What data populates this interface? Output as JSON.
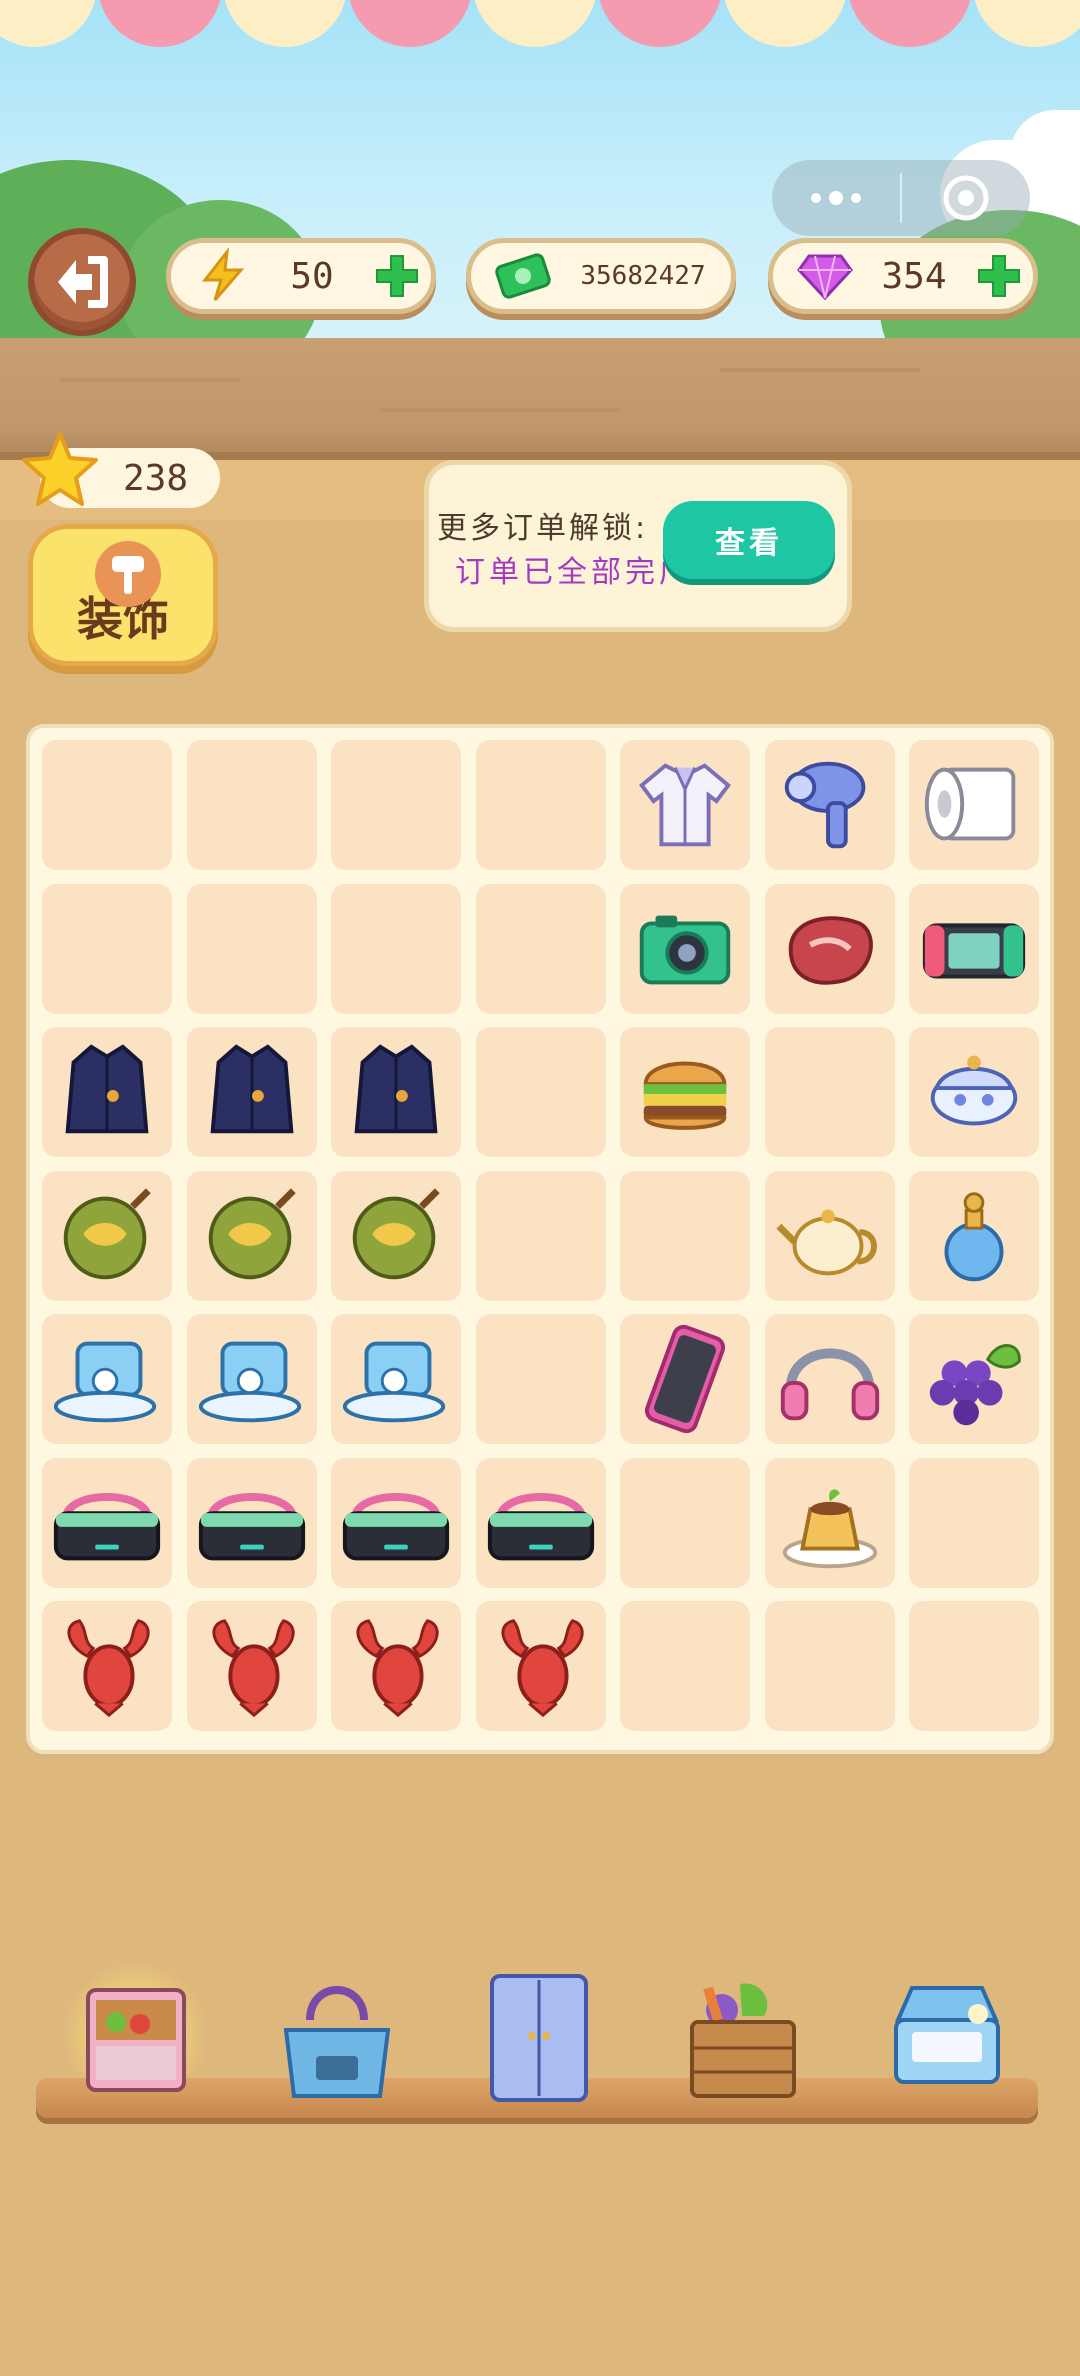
{
  "header": {
    "energy": "50",
    "cash": "35682427",
    "gems": "354"
  },
  "stars": "238",
  "decorate_label": "装饰",
  "order_notice": {
    "line1": "更多订单解锁:",
    "line2": "订单已全部完成",
    "view_label": "查看"
  },
  "board": {
    "rows": 7,
    "cols": 7,
    "cells": [
      [
        "empty",
        "empty",
        "empty",
        "empty",
        "shirt",
        "hair-dryer",
        "toilet-paper"
      ],
      [
        "empty",
        "empty",
        "empty",
        "empty",
        "camera",
        "steak",
        "game-console"
      ],
      [
        "coat",
        "coat",
        "coat",
        "empty",
        "burger",
        "empty",
        "sugar-bowl"
      ],
      [
        "durian",
        "durian",
        "durian",
        "empty",
        "empty",
        "teapot",
        "perfume"
      ],
      [
        "robot-vacuum",
        "robot-vacuum",
        "robot-vacuum",
        "empty",
        "smartphone",
        "headphones",
        "grapes"
      ],
      [
        "vr-headset",
        "vr-headset",
        "vr-headset",
        "vr-headset",
        "empty",
        "pudding",
        "empty"
      ],
      [
        "lobster",
        "lobster",
        "lobster",
        "lobster",
        "empty",
        "empty",
        "empty"
      ]
    ]
  },
  "shelf": [
    "food-cart",
    "handbag",
    "wardrobe",
    "vegetable-crate",
    "suitcase"
  ],
  "colors": {
    "accent_green": "#1ec6a3",
    "board_cell": "#fbe2c2",
    "decor_yellow": "#fbe36b"
  }
}
